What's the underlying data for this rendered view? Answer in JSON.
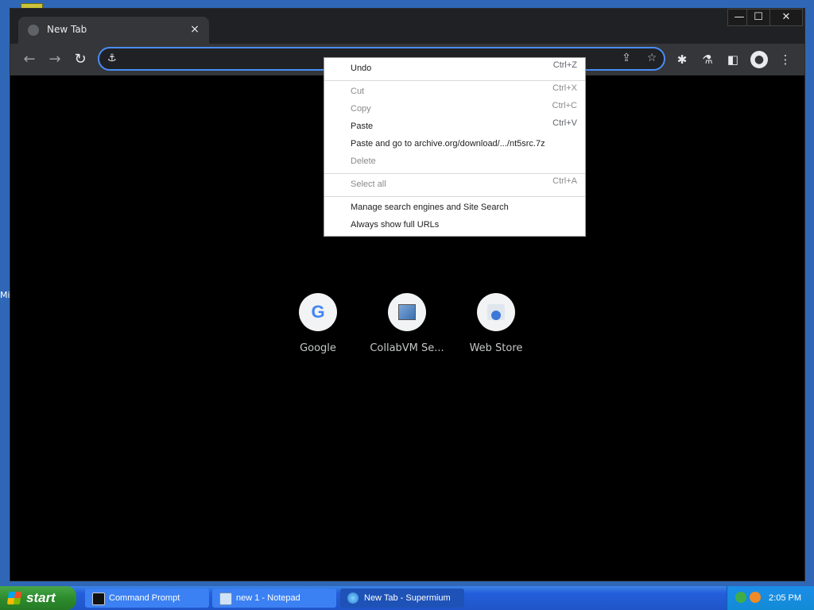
{
  "desktop": {
    "icon_label": "Mi"
  },
  "browser": {
    "tab": {
      "title": "New Tab",
      "close_glyph": "×",
      "favicon": "globe-icon"
    },
    "window_controls": {
      "minimize": "—",
      "maximize": "☐",
      "close": "✕"
    },
    "toolbar": {
      "back_glyph": "←",
      "forward_glyph": "→",
      "reload_glyph": "↻",
      "omnibox": {
        "value": "",
        "placeholder": "",
        "site_icon_glyph": "⚓"
      },
      "share_glyph": "⇪",
      "bookmark_glyph": "☆",
      "extensions_glyph": "✱",
      "labs_glyph": "⚗",
      "sidepanel_glyph": "◧",
      "profile_glyph": "●",
      "menu_glyph": "⋮"
    },
    "shortcuts": [
      {
        "label": "Google",
        "icon": "google-icon",
        "glyph": "G"
      },
      {
        "label": "CollabVM Se...",
        "icon": "collabvm-icon"
      },
      {
        "label": "Web Store",
        "icon": "web-store-icon"
      }
    ],
    "context_menu": {
      "items": [
        {
          "label": "Undo",
          "shortcut": "Ctrl+Z",
          "enabled": true
        },
        {
          "label": "Cut",
          "shortcut": "Ctrl+X",
          "enabled": false
        },
        {
          "label": "Copy",
          "shortcut": "Ctrl+C",
          "enabled": false
        },
        {
          "label": "Paste",
          "shortcut": "Ctrl+V",
          "enabled": true
        },
        {
          "label": "Paste and go to archive.org/download/.../nt5src.7z",
          "shortcut": "",
          "enabled": true
        },
        {
          "label": "Delete",
          "shortcut": "",
          "enabled": false
        },
        {
          "label": "Select all",
          "shortcut": "Ctrl+A",
          "enabled": false
        },
        {
          "label": "Manage search engines and Site Search",
          "shortcut": "",
          "enabled": true
        },
        {
          "label": "Always show full URLs",
          "shortcut": "",
          "enabled": true
        }
      ]
    }
  },
  "taskbar": {
    "start_label": "start",
    "tasks": [
      {
        "label": "Command Prompt",
        "icon": "cmd-icon",
        "active": false
      },
      {
        "label": "new 1 - Notepad",
        "icon": "notepad-icon",
        "active": false
      },
      {
        "label": "New Tab - Supermium",
        "icon": "supermium-icon",
        "active": true
      }
    ],
    "tray_icons": [
      "network-icon",
      "search-icon"
    ],
    "clock": "2:05 PM"
  },
  "colors": {
    "accent": "#4a8df7",
    "desktop": "#2f67b6",
    "taskbar": "#245edb",
    "start_green": "#2d8c2d"
  }
}
